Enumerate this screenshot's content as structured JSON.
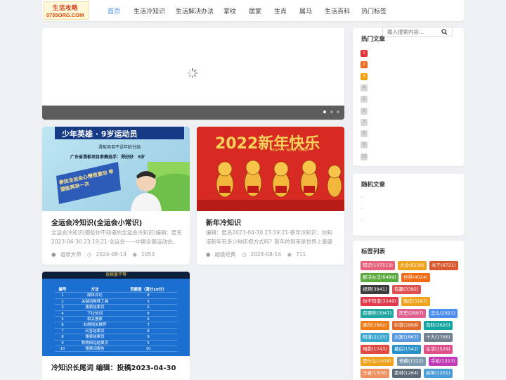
{
  "site": {
    "logo_line1": "生活攻略",
    "logo_line2": "0755ORG.COM"
  },
  "nav": [
    "首页",
    "生活冷知识",
    "生活解决办法",
    "掌纹",
    "居家",
    "生肖",
    "属马",
    "生活百科",
    "热门标签"
  ],
  "slider": {
    "dots": 3,
    "active_dot": 1
  },
  "cards": [
    {
      "title": "全运会冷知识(全运会小常识)",
      "desc": "全运会冷知识(那些你不知道的全运会冷知识)编辑：匿名 2023-04-30 23:19:21-全运会——中国全国运动会。是中国",
      "author": "语录大师",
      "date": "2024-08-14",
      "views": "1053",
      "image_text": {
        "banner": "少年英雄 · 9岁运动员",
        "line1": "滑板项目不设年龄分组",
        "line2": "广东省滑板项目参赛选手：郑好好　9岁",
        "sign": "参加全运会心情很激动 希望能再来一次"
      }
    },
    {
      "title": "新年冷知识",
      "desc": "编辑：匿名2023-04-30 23:19:21-新年冷知识：你知道新年有多少种庆祝方式吗？新年的到来是世界上最盛大的庆祝",
      "author": "超级经典",
      "date": "2024-08-14",
      "views": "711",
      "image_text": {
        "headline": "2022新年快乐",
        "sub": "HAPPY NEW YEAR"
      }
    },
    {
      "title": "冷知识长尾词 编辑：投稿2023-04-30",
      "image_text": {
        "header": "贡献度不等",
        "columns": [
          "编号",
          "方法",
          "贡献度（满分10分）"
        ],
        "rows": [
          [
            "1",
            "媒体评论",
            "8"
          ],
          [
            "2",
            "关键词推荐工具",
            "5"
          ],
          [
            "3",
            "搜索结果页",
            "5"
          ],
          [
            "4",
            "下拉热词",
            "6"
          ],
          [
            "5",
            "相关搜索",
            "6"
          ],
          [
            "6",
            "右侧相关推荐",
            "7"
          ],
          [
            "7",
            "问答结果页",
            "8"
          ],
          [
            "8",
            "搜索结果页",
            "9"
          ],
          [
            "9",
            "购物网站结果页",
            "5"
          ],
          [
            "10",
            "搜索词报告",
            "10"
          ]
        ]
      }
    }
  ],
  "sidebar": {
    "hot_title": "热门文章",
    "search_placeholder": "输入搜索内容...",
    "hot_ranks": [
      "1",
      "2",
      "3",
      "4",
      "5",
      "6",
      "7",
      "8",
      "9",
      "10"
    ],
    "hot_colors": [
      "#e8323a",
      "#f06c1c",
      "#f2a20d",
      "#d8d8d8",
      "#d8d8d8",
      "#d8d8d8",
      "#d8d8d8",
      "#d8d8d8",
      "#d8d8d8",
      "#d8d8d8"
    ],
    "random_title": "随机文章",
    "random_items": [
      "·",
      "·",
      "·"
    ],
    "tags_title": "标签列表",
    "tags": [
      {
        "label": "知识(107513)",
        "color": "#e85f7a"
      },
      {
        "label": "大全(6136)",
        "color": "#f0a21c"
      },
      {
        "label": "关于(6721)",
        "color": "#d9572a"
      },
      {
        "label": "解决办法(6489)",
        "color": "#5aaa3e"
      },
      {
        "label": "世界(4024)",
        "color": "#f26a14"
      },
      {
        "label": "视频(3941)",
        "color": "#3c3c3c"
      },
      {
        "label": "有趣(3382)",
        "color": "#e05050"
      },
      {
        "label": "你不知道(3249)",
        "color": "#e1394a"
      },
      {
        "label": "微信(3187)",
        "color": "#f0a21c"
      },
      {
        "label": "有哪些(3047)",
        "color": "#22a7a0"
      },
      {
        "label": "历史(2997)",
        "color": "#e06090"
      },
      {
        "label": "怎么(2921)",
        "color": "#4c8ff0"
      },
      {
        "label": "真的(2882)",
        "color": "#f07a14"
      },
      {
        "label": "科普(2868)",
        "color": "#e06b2a"
      },
      {
        "label": "百科(2620)",
        "color": "#14a6a0"
      },
      {
        "label": "知道(2115)",
        "color": "#3ca8d0"
      },
      {
        "label": "文案(1867)",
        "color": "#5a9ae0"
      },
      {
        "label": "十大(1766)",
        "color": "#708090"
      },
      {
        "label": "电影(1743)",
        "color": "#e04a40"
      },
      {
        "label": "幕后(1542)",
        "color": "#2c91c8"
      },
      {
        "label": "生活(1529)",
        "color": "#e0508a"
      },
      {
        "label": "是什么(1418)",
        "color": "#f0a21c"
      },
      {
        "label": "奇葩(1322)",
        "color": "#7c9bb0"
      },
      {
        "label": "手机(1313)",
        "color": "#c23ab8"
      },
      {
        "label": "王者(1309)",
        "color": "#f09060"
      },
      {
        "label": "素材(1264)",
        "color": "#5c6a78"
      },
      {
        "label": "搞笑(1201)",
        "color": "#4a9ed8"
      }
    ]
  }
}
